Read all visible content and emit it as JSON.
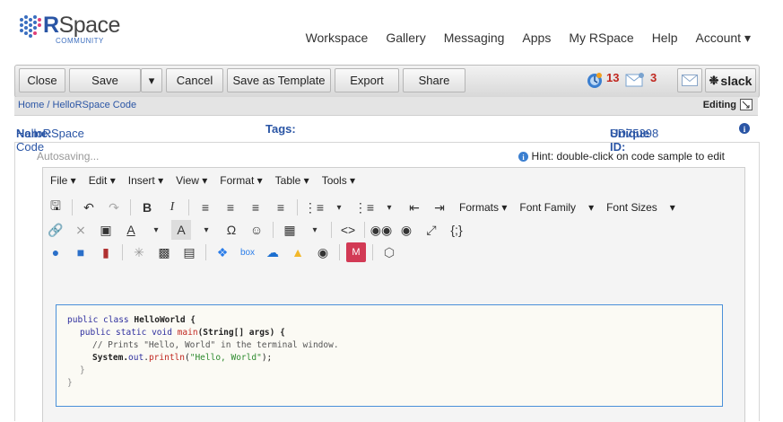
{
  "brand": {
    "name_bold": "R",
    "name_rest": "Space",
    "subtitle": "COMMUNITY"
  },
  "nav": [
    "Workspace",
    "Gallery",
    "Messaging",
    "Apps",
    "My RSpace",
    "Help",
    "Account ▾"
  ],
  "toolbar": {
    "close": "Close",
    "save": "Save",
    "save_caret": "▾",
    "cancel": "Cancel",
    "save_template": "Save as Template",
    "export": "Export",
    "share": "Share",
    "notification_count": "13",
    "message_count": "3",
    "slack": "slack"
  },
  "breadcrumb": {
    "text": "Home / HelloRSpace Code",
    "editing": "Editing"
  },
  "doc": {
    "name_label": "Name:",
    "name_value": "HelloRSpace Code",
    "tags_label": "Tags:",
    "uid_label": "Unique ID:",
    "uid_value": "SD75398"
  },
  "status": {
    "autosave": "Autosaving...",
    "hint": "Hint: double-click on code sample to edit"
  },
  "menu": [
    "File ▾",
    "Edit ▾",
    "Insert ▾",
    "View ▾",
    "Format ▾",
    "Table ▾",
    "Tools ▾"
  ],
  "format_dropdowns": {
    "formats": "Formats ▾",
    "font_family": "Font Family",
    "font_family_caret": "▾",
    "font_sizes": "Font Sizes",
    "font_sizes_caret": "▾"
  },
  "code": {
    "l1a": "public class ",
    "l1b": "HelloWorld {",
    "l2a": "public static void ",
    "l2b": "main",
    "l2c": "(String[] args) {",
    "l3": "// Prints \"Hello, World\" in the terminal window.",
    "l4a": "System.",
    "l4b": "out",
    "l4c": ".",
    "l4d": "println",
    "l4e": "(",
    "l4f": "\"Hello, World\"",
    "l4g": ");",
    "l5": "}",
    "l6": "}"
  },
  "colors": {
    "brand_blue": "#2a55a5",
    "badge_red": "#c0271f",
    "code_border": "#4a90d9"
  }
}
